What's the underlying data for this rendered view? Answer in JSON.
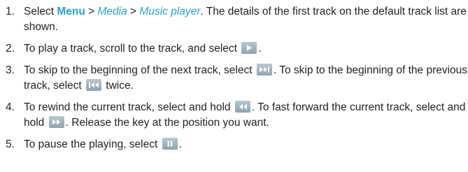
{
  "steps": [
    {
      "num": "1.",
      "a": "Select ",
      "menu": "Menu",
      "sep1": " > ",
      "media": "Media",
      "sep2": " > ",
      "player": "Music player",
      "b": ". The details of the first track on the default track list are shown."
    },
    {
      "num": "2.",
      "a": "To play a track, scroll to the track, and select ",
      "b": "."
    },
    {
      "num": "3.",
      "a": "To skip to the beginning of the next track, select ",
      "b": ". To skip to the beginning of the previous track, select ",
      "c": " twice."
    },
    {
      "num": "4.",
      "a": "To rewind the current track, select and hold ",
      "b": ". To fast forward the current track, select and hold ",
      "c": ". Release the key at the position you want."
    },
    {
      "num": "5.",
      "a": "To pause the playing, select ",
      "b": "."
    }
  ],
  "icons": [
    "play-icon",
    "next-track-icon",
    "previous-track-icon",
    "rewind-icon",
    "fast-forward-icon",
    "pause-icon"
  ]
}
